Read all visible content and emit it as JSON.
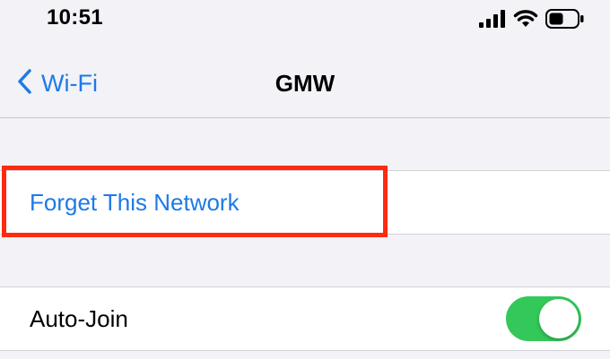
{
  "status_bar": {
    "time": "10:51",
    "icons": [
      "cellular-signal-icon",
      "wifi-icon",
      "battery-icon"
    ]
  },
  "nav": {
    "back_label": "Wi-Fi",
    "back_icon": "chevron-left-icon",
    "title": "GMW"
  },
  "actions": {
    "forget_label": "Forget This Network"
  },
  "settings": {
    "auto_join_label": "Auto-Join",
    "auto_join_enabled": true
  },
  "colors": {
    "accent": "#1e7ae6",
    "toggle_on": "#34c759",
    "highlight": "#ff2a10",
    "background": "#f2f2f7"
  }
}
